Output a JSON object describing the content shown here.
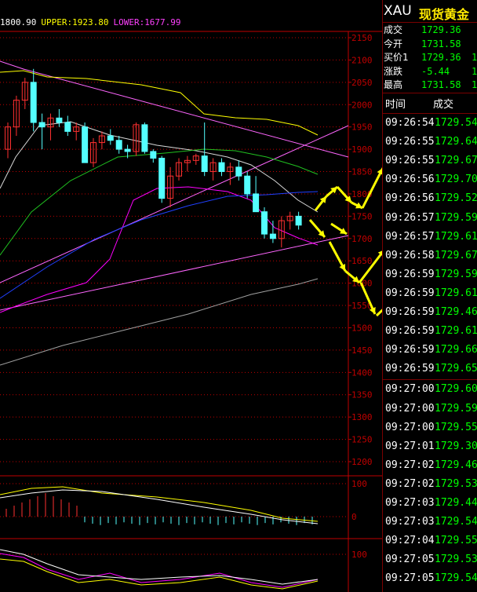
{
  "indicator_bar": {
    "mid": "1800.90",
    "upper": "UPPER:1923.80",
    "lower": "LOWER:1677.99"
  },
  "colors": {
    "background": "#000000",
    "axis": "#c00000",
    "bull_candle": "#ff3030",
    "bear_candle": "#54ffff",
    "upper_band": "#ffff00",
    "lower_band": "#ff00ff",
    "trend_lines": "#ff66ff",
    "arrows": "#ffff00",
    "price_green": "#00ff00"
  },
  "price_axis": {
    "ticks": [
      "2150",
      "2100",
      "2050",
      "2000",
      "1950",
      "1900",
      "1850",
      "1800",
      "1750",
      "1700",
      "1650",
      "1600",
      "1550",
      "1500",
      "1450",
      "1400",
      "1350",
      "1300",
      "1250",
      "1200"
    ]
  },
  "sub1_axis": {
    "ticks": [
      "100",
      "0"
    ]
  },
  "sub2_axis": {
    "ticks": [
      "100"
    ]
  },
  "quote": {
    "symbol": "XAU",
    "name": "现货黄金",
    "rows": [
      {
        "label": "成交",
        "value": "1729.36",
        "tail": ""
      },
      {
        "label": "今开",
        "value": "1731.58",
        "tail": ""
      },
      {
        "label": "买价1",
        "value": "1729.36",
        "tail": "1"
      },
      {
        "label": "涨跌",
        "value": "-5.44",
        "tail": "1"
      },
      {
        "label": "最高",
        "value": "1731.58",
        "tail": "1"
      }
    ]
  },
  "ticks_header": {
    "time": "时间",
    "price": "成交"
  },
  "ticks": [
    {
      "time": "09:26:54",
      "price": "1729.54"
    },
    {
      "time": "09:26:55",
      "price": "1729.64"
    },
    {
      "time": "09:26:55",
      "price": "1729.67"
    },
    {
      "time": "09:26:56",
      "price": "1729.70"
    },
    {
      "time": "09:26:56",
      "price": "1729.52"
    },
    {
      "time": "09:26:57",
      "price": "1729.59"
    },
    {
      "time": "09:26:57",
      "price": "1729.61"
    },
    {
      "time": "09:26:58",
      "price": "1729.67"
    },
    {
      "time": "09:26:59",
      "price": "1729.59"
    },
    {
      "time": "09:26:59",
      "price": "1729.61"
    },
    {
      "time": "09:26:59",
      "price": "1729.46"
    },
    {
      "time": "09:26:59",
      "price": "1729.61"
    },
    {
      "time": "09:26:59",
      "price": "1729.66"
    },
    {
      "time": "09:26:59",
      "price": "1729.65"
    },
    {
      "time": "09:27:00",
      "price": "1729.60"
    },
    {
      "time": "09:27:00",
      "price": "1729.59"
    },
    {
      "time": "09:27:00",
      "price": "1729.55"
    },
    {
      "time": "09:27:01",
      "price": "1729.30"
    },
    {
      "time": "09:27:02",
      "price": "1729.46"
    },
    {
      "time": "09:27:02",
      "price": "1729.53"
    },
    {
      "time": "09:27:03",
      "price": "1729.44"
    },
    {
      "time": "09:27:03",
      "price": "1729.54"
    },
    {
      "time": "09:27:04",
      "price": "1729.55"
    },
    {
      "time": "09:27:05",
      "price": "1729.53"
    },
    {
      "time": "09:27:05",
      "price": "1729.54"
    }
  ],
  "chart_data": {
    "type": "candlestick",
    "candles_ohlc": [
      [
        1900,
        1960,
        1880,
        1950
      ],
      [
        1950,
        2020,
        1930,
        2010
      ],
      [
        2010,
        2060,
        1990,
        2050
      ],
      [
        2050,
        2080,
        1940,
        1960
      ],
      [
        1960,
        1980,
        1900,
        1950
      ],
      [
        1950,
        1980,
        1920,
        1970
      ],
      [
        1970,
        1990,
        1950,
        1960
      ],
      [
        1960,
        1975,
        1930,
        1940
      ],
      [
        1940,
        1960,
        1920,
        1950
      ],
      [
        1950,
        1960,
        1870,
        1870
      ],
      [
        1870,
        1925,
        1860,
        1915
      ],
      [
        1915,
        1940,
        1900,
        1930
      ],
      [
        1930,
        1945,
        1910,
        1920
      ],
      [
        1920,
        1930,
        1890,
        1900
      ],
      [
        1900,
        1910,
        1880,
        1895
      ],
      [
        1895,
        1960,
        1885,
        1955
      ],
      [
        1955,
        1960,
        1890,
        1895
      ],
      [
        1895,
        1900,
        1870,
        1880
      ],
      [
        1880,
        1885,
        1780,
        1790
      ],
      [
        1790,
        1860,
        1770,
        1840
      ],
      [
        1840,
        1880,
        1830,
        1870
      ],
      [
        1870,
        1885,
        1850,
        1875
      ],
      [
        1875,
        1890,
        1865,
        1885
      ],
      [
        1885,
        1960,
        1840,
        1850
      ],
      [
        1850,
        1880,
        1830,
        1870
      ],
      [
        1870,
        1880,
        1840,
        1850
      ],
      [
        1850,
        1870,
        1820,
        1860
      ],
      [
        1860,
        1875,
        1830,
        1840
      ],
      [
        1840,
        1850,
        1790,
        1800
      ],
      [
        1800,
        1840,
        1760,
        1760
      ],
      [
        1760,
        1770,
        1700,
        1710
      ],
      [
        1710,
        1740,
        1690,
        1700
      ],
      [
        1700,
        1750,
        1680,
        1740
      ],
      [
        1740,
        1760,
        1720,
        1750
      ],
      [
        1750,
        1760,
        1720,
        1730
      ]
    ],
    "y_range": [
      1200,
      2150
    ]
  }
}
